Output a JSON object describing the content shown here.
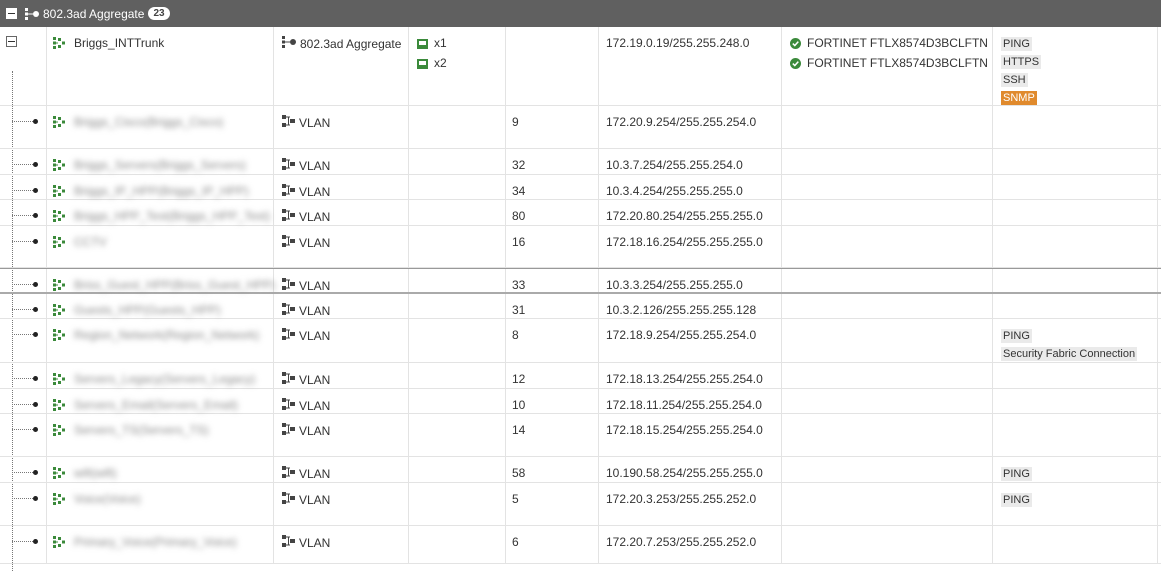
{
  "group": {
    "title": "802.3ad Aggregate",
    "count": "23"
  },
  "rows": [
    {
      "name": "Briggs_INTTrunk",
      "blur": false,
      "type": "802.3ad Aggregate",
      "members": [
        "x1",
        "x2"
      ],
      "vlan": "",
      "ip": "172.19.0.19/255.255.248.0",
      "fortilink": [
        "FORTINET FTLX8574D3BCLFTN",
        "FORTINET FTLX8574D3BCLFTN"
      ],
      "access": [
        "PING",
        "HTTPS",
        "SSH",
        "SNMP"
      ]
    },
    {
      "name": "Briggs_Cisco(Briggs_Cisco)",
      "blur": true,
      "type": "VLAN",
      "vlan": "9",
      "ip": "172.20.9.254/255.255.254.0",
      "access": []
    },
    {
      "name": "Briggs_Servers(Briggs_Servers)",
      "blur": true,
      "type": "VLAN",
      "vlan": "32",
      "ip": "10.3.7.254/255.255.254.0",
      "access": []
    },
    {
      "name": "Briggs_IP_HPP(Briggs_IP_HPP)",
      "blur": true,
      "type": "VLAN",
      "vlan": "34",
      "ip": "10.3.4.254/255.255.255.0",
      "access": []
    },
    {
      "name": "Briggs_HPP_Test(Briggs_HPP_Test)",
      "blur": true,
      "type": "VLAN",
      "vlan": "80",
      "ip": "172.20.80.254/255.255.255.0",
      "access": []
    },
    {
      "name": "CCTV",
      "blur": true,
      "type": "VLAN",
      "vlan": "16",
      "ip": "172.18.16.254/255.255.255.0",
      "access": []
    },
    {
      "name": "Briss_Guest_HPP(Briss_Guest_HPP)",
      "blur": true,
      "type": "VLAN",
      "vlan": "33",
      "ip": "10.3.3.254/255.255.255.0",
      "access": []
    },
    {
      "name": "Guests_HPP(Guests_HPP)",
      "blur": true,
      "type": "VLAN",
      "vlan": "31",
      "ip": "10.3.2.126/255.255.255.128",
      "access": []
    },
    {
      "name": "Region_Network(Region_Network)",
      "blur": true,
      "type": "VLAN",
      "vlan": "8",
      "ip": "172.18.9.254/255.255.254.0",
      "access": [
        "PING",
        "Security Fabric Connection"
      ]
    },
    {
      "name": "Servers_Legacy(Servers_Legacy)",
      "blur": true,
      "type": "VLAN",
      "vlan": "12",
      "ip": "172.18.13.254/255.255.254.0",
      "access": []
    },
    {
      "name": "Servers_Email(Servers_Email)",
      "blur": true,
      "type": "VLAN",
      "vlan": "10",
      "ip": "172.18.11.254/255.255.254.0",
      "access": []
    },
    {
      "name": "Servers_TS(Servers_TS)",
      "blur": true,
      "type": "VLAN",
      "vlan": "14",
      "ip": "172.18.15.254/255.255.254.0",
      "access": []
    },
    {
      "name": "wifi(wifi)",
      "blur": true,
      "type": "VLAN",
      "vlan": "58",
      "ip": "10.190.58.254/255.255.255.0",
      "access": [
        "PING"
      ]
    },
    {
      "name": "Voice(Voice)",
      "blur": true,
      "type": "VLAN",
      "vlan": "5",
      "ip": "172.20.3.253/255.255.252.0",
      "access": [
        "PING"
      ]
    },
    {
      "name": "Primary_Voice(Primary_Voice)",
      "blur": true,
      "type": "VLAN",
      "vlan": "6",
      "ip": "172.20.7.253/255.255.252.0",
      "access": []
    }
  ]
}
